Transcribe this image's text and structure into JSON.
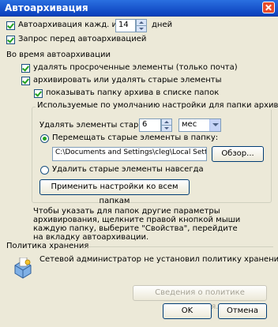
{
  "window": {
    "title": "Автоархивация"
  },
  "autoarchive": {
    "checked": true,
    "label": "Автоархивация кажд. из",
    "value": "14",
    "unit": "дней"
  },
  "prompt": {
    "checked": true,
    "label": "Запрос перед автоархивацией"
  },
  "during_section": {
    "label": "Во время автоархивации"
  },
  "delete_expired": {
    "checked": true,
    "label": "удалять просроченные элементы (только почта)"
  },
  "archive_old": {
    "checked": true,
    "label": "архивировать или удалять старые элементы"
  },
  "show_folder": {
    "checked": true,
    "label": "показывать папку архива в списке папок"
  },
  "defaults_group": {
    "title": "Используемые по умолчанию настройки для папки архива",
    "delete_older_label": "Удалять элементы старше",
    "age_value": "6",
    "age_unit": "мес",
    "move_radio": {
      "checked": true,
      "label": "Перемещать старые элементы в папку:"
    },
    "path": "C:\\Documents and Settings\\cleg\\Local Settin",
    "browse_label": "Обзор...",
    "delete_radio": {
      "checked": false,
      "label": "Удалить старые элементы навсегда"
    },
    "apply_all_label": "Применить настройки ко всем папкам"
  },
  "note": "Чтобы указать для папок другие параметры архивирования, щелкните правой кнопкой мыши каждую папку, выберите \"Свойства\", перейдите на вкладку автоархивации.",
  "retention": {
    "title": "Политика хранения",
    "message": "Сетевой администратор не установил политику хранения.",
    "info_button": "Сведения о политике хранения..."
  },
  "buttons": {
    "ok": "OK",
    "cancel": "Отмена"
  }
}
